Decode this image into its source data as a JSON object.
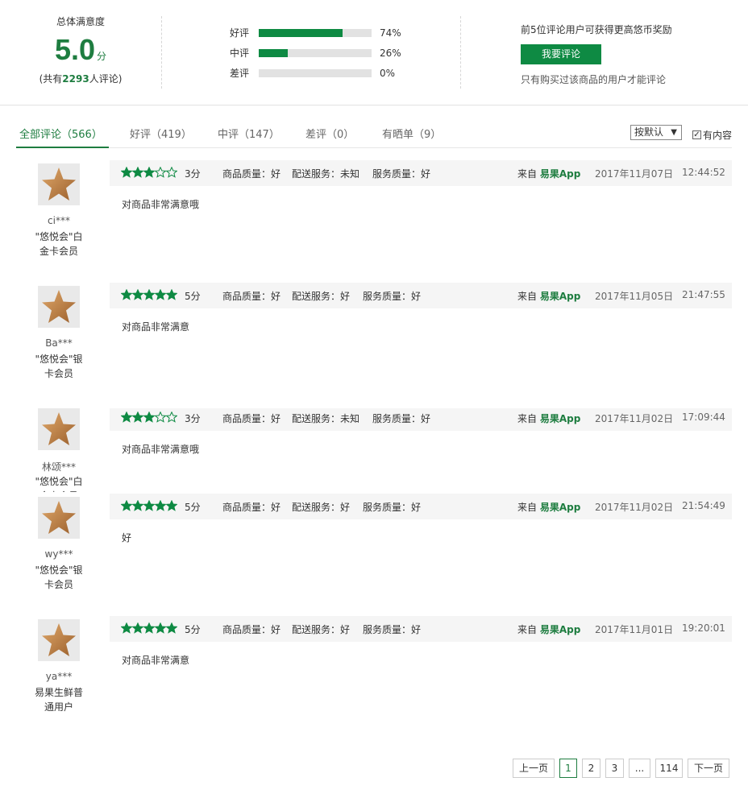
{
  "summary": {
    "satisfaction_label": "总体满意度",
    "score": "5.0",
    "score_unit": "分",
    "count_prefix": "(共有",
    "count": "2293",
    "count_suffix": "人评论)",
    "distribution": [
      {
        "label": "好评",
        "percent": 74,
        "percent_text": "74%"
      },
      {
        "label": "中评",
        "percent": 26,
        "percent_text": "26%"
      },
      {
        "label": "差评",
        "percent": 0,
        "percent_text": "0%"
      }
    ],
    "reward_tip": "前5位评论用户可获得更高悠币奖励",
    "review_button": "我要评论",
    "reward_note": "只有购买过该商品的用户才能评论"
  },
  "tabs": [
    {
      "label": "全部评论（566）",
      "active": true
    },
    {
      "label": "好评（419）",
      "active": false
    },
    {
      "label": "中评（147）",
      "active": false
    },
    {
      "label": "差评（0）",
      "active": false
    },
    {
      "label": "有晒单（9）",
      "active": false
    }
  ],
  "sort": {
    "selected": "按默认",
    "caret": "▼"
  },
  "filter": {
    "label": "有内容",
    "checked": true
  },
  "colors": {
    "accent": "#1e7d40",
    "bar": "#0e8a43",
    "star_gold": "#c98a4a"
  },
  "reviews": [
    {
      "user": "ci***",
      "level": "\"悠悦会\"白金卡会员",
      "stars": 3,
      "score": "3分",
      "quality": "商品质量：好",
      "delivery": "配送服务：未知",
      "service": "服务质量：好",
      "from_prefix": "来自",
      "from_app": "易果App",
      "date": "2017年11月07日",
      "time": "12:44:52",
      "content": "对商品非常满意哦"
    },
    {
      "user": "Ba***",
      "level": "\"悠悦会\"银卡会员",
      "stars": 5,
      "score": "5分",
      "quality": "商品质量：好",
      "delivery": "配送服务：好",
      "service": "服务质量：好",
      "from_prefix": "来自",
      "from_app": "易果App",
      "date": "2017年11月05日",
      "time": "21:47:55",
      "content": "对商品非常满意"
    },
    {
      "user": "林颂***",
      "level": "\"悠悦会\"白金卡会员",
      "stars": 3,
      "score": "3分",
      "quality": "商品质量：好",
      "delivery": "配送服务：未知",
      "service": "服务质量：好",
      "from_prefix": "来自",
      "from_app": "易果App",
      "date": "2017年11月02日",
      "time": "17:09:44",
      "content": "对商品非常满意哦"
    },
    {
      "user": "wy***",
      "level": "\"悠悦会\"银卡会员",
      "stars": 5,
      "score": "5分",
      "quality": "商品质量：好",
      "delivery": "配送服务：好",
      "service": "服务质量：好",
      "from_prefix": "来自",
      "from_app": "易果App",
      "date": "2017年11月02日",
      "time": "21:54:49",
      "content": "好"
    },
    {
      "user": "ya***",
      "level": "易果生鲜普通用户",
      "stars": 5,
      "score": "5分",
      "quality": "商品质量：好",
      "delivery": "配送服务：好",
      "service": "服务质量：好",
      "from_prefix": "来自",
      "from_app": "易果App",
      "date": "2017年11月01日",
      "time": "19:20:01",
      "content": "对商品非常满意"
    }
  ],
  "pagination": {
    "prev": "上一页",
    "pages": [
      "1",
      "2",
      "3",
      "...",
      "114"
    ],
    "current": "1",
    "next": "下一页"
  }
}
